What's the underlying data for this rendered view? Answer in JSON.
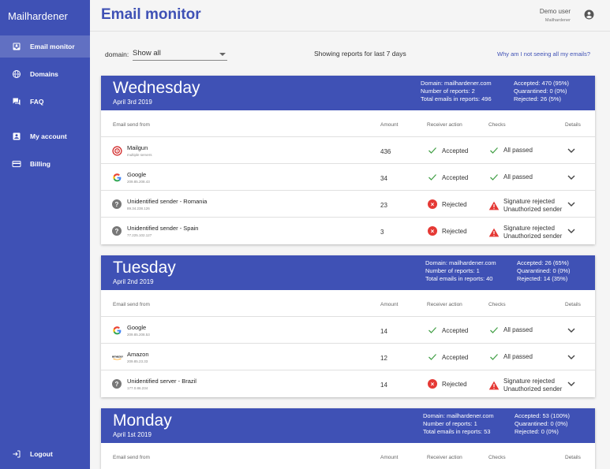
{
  "app": {
    "name": "Mailhardener"
  },
  "nav": [
    {
      "label": "Email monitor",
      "icon": "inbox-icon"
    },
    {
      "label": "Domains",
      "icon": "globe-icon"
    },
    {
      "label": "FAQ",
      "icon": "forum-icon"
    },
    {
      "label": "My account",
      "icon": "account-box-icon"
    },
    {
      "label": "Billing",
      "icon": "credit-card-icon"
    },
    {
      "label": "Logout",
      "icon": "logout-icon"
    }
  ],
  "page": {
    "title": "Email monitor"
  },
  "user": {
    "name": "Demo user",
    "org": "Mailhardener"
  },
  "filter": {
    "label": "domain:",
    "value": "Show all",
    "showing": "Showing reports for last 7 days",
    "help_link": "Why am I not seeing all my emails?"
  },
  "columns": {
    "from": "Email send from",
    "amount": "Amount",
    "action": "Receiver action",
    "checks": "Checks",
    "details": "Details"
  },
  "days": [
    {
      "day": "Wednesday",
      "date": "April 3rd 2019",
      "stats1": [
        "Domain: mailhardener.com",
        "Number of reports: 2",
        "Total emails in reports: 496"
      ],
      "stats2": [
        "Accepted: 470 (95%)",
        "Quarantined: 0 (0%)",
        "Rejected: 26 (5%)"
      ],
      "rows": [
        {
          "icon": "mailgun-logo-icon",
          "name": "Mailgun",
          "sub": "multiple servers",
          "amount": "436",
          "action": "Accepted",
          "checks": [
            "All passed"
          ]
        },
        {
          "icon": "google-logo-icon",
          "name": "Google",
          "sub": "209.85.208.43",
          "amount": "34",
          "action": "Accepted",
          "checks": [
            "All passed"
          ]
        },
        {
          "icon": "unknown-sender-icon",
          "name": "Unidentified sender - Romania",
          "sub": "89.34.238.126",
          "amount": "23",
          "action": "Rejected",
          "checks": [
            "Signature rejected",
            "Unauthorized sender"
          ]
        },
        {
          "icon": "unknown-sender-icon",
          "name": "Unidentified sender - Spain",
          "sub": "77.225.102.127",
          "amount": "3",
          "action": "Rejected",
          "checks": [
            "Signature rejected",
            "Unauthorized sender"
          ]
        }
      ]
    },
    {
      "day": "Tuesday",
      "date": "April 2nd 2019",
      "stats1": [
        "Domain: mailhardener.com",
        "Number of reports: 1",
        "Total emails in reports: 40"
      ],
      "stats2": [
        "Accepted: 26 (65%)",
        "Quarantined: 0 (0%)",
        "Rejected: 14 (35%)"
      ],
      "rows": [
        {
          "icon": "google-logo-icon",
          "name": "Google",
          "sub": "209.85.208.53",
          "amount": "14",
          "action": "Accepted",
          "checks": [
            "All passed"
          ]
        },
        {
          "icon": "amazon-logo-icon",
          "name": "Amazon",
          "sub": "209.85.23.33",
          "amount": "12",
          "action": "Accepted",
          "checks": [
            "All passed"
          ]
        },
        {
          "icon": "unknown-sender-icon",
          "name": "Unidentified server - Brazil",
          "sub": "177.0.86.234",
          "amount": "14",
          "action": "Rejected",
          "checks": [
            "Signature rejected",
            "Unauthorized sender"
          ]
        }
      ]
    },
    {
      "day": "Monday",
      "date": "April 1st 2019",
      "stats1": [
        "Domain: mailhardener.com",
        "Number of reports: 1",
        "Total emails in reports: 53"
      ],
      "stats2": [
        "Accepted: 53 (100%)",
        "Quarantined: 0 (0%)",
        "Rejected: 0 (0%)"
      ],
      "rows": []
    }
  ],
  "colors": {
    "primary": "#3f51b5",
    "accept": "#43a047",
    "reject": "#e53935"
  }
}
